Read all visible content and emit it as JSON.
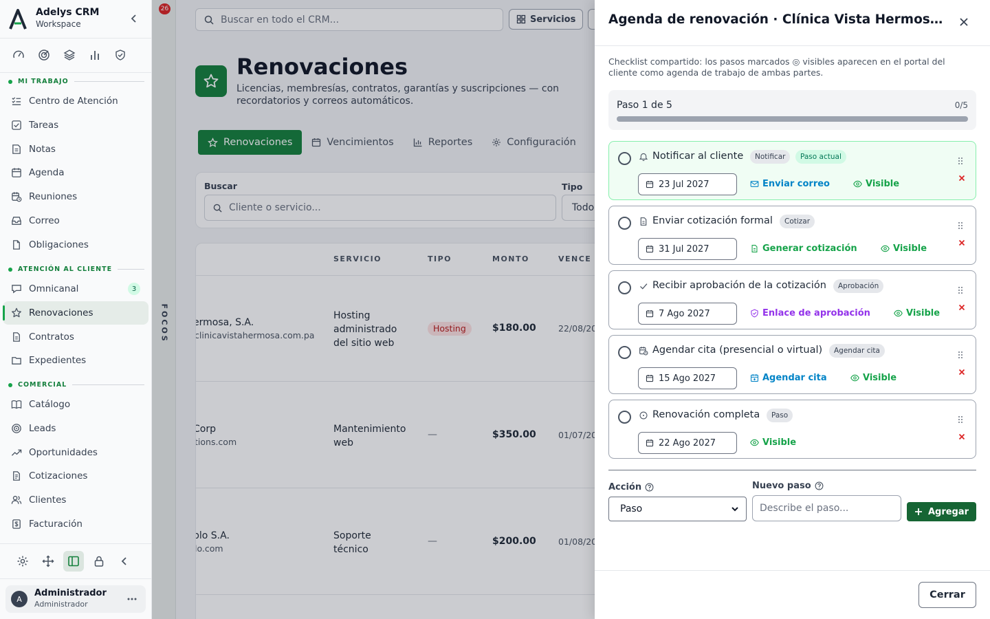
{
  "sidebar": {
    "brand_name": "Adelys CRM",
    "brand_sub": "Workspace",
    "sections": [
      {
        "label": "MI TRABAJO",
        "items": [
          {
            "label": "Centro de Atención",
            "icon": "list-check-icon"
          },
          {
            "label": "Tareas",
            "icon": "checkbox-icon"
          },
          {
            "label": "Notas",
            "icon": "note-icon"
          },
          {
            "label": "Agenda",
            "icon": "calendar-icon"
          },
          {
            "label": "Reuniones",
            "icon": "calendar-clock-icon"
          },
          {
            "label": "Correo",
            "icon": "inbox-icon"
          },
          {
            "label": "Obligaciones",
            "icon": "file-icon"
          }
        ]
      },
      {
        "label": "ATENCIÓN AL CLIENTE",
        "items": [
          {
            "label": "Omnicanal",
            "icon": "chat-icon",
            "badge": "3"
          },
          {
            "label": "Renovaciones",
            "icon": "star-icon",
            "active": true
          },
          {
            "label": "Contratos",
            "icon": "document-icon"
          },
          {
            "label": "Expedientes",
            "icon": "folder-icon"
          }
        ]
      },
      {
        "label": "COMERCIAL",
        "items": [
          {
            "label": "Catálogo",
            "icon": "book-icon"
          },
          {
            "label": "Leads",
            "icon": "target-icon"
          },
          {
            "label": "Oportunidades",
            "icon": "trend-icon"
          },
          {
            "label": "Cotizaciones",
            "icon": "quote-icon"
          },
          {
            "label": "Clientes",
            "icon": "users-icon"
          },
          {
            "label": "Facturación",
            "icon": "invoice-icon"
          }
        ]
      }
    ],
    "user_name": "Administrador",
    "user_role": "Administrador",
    "user_initial": "A"
  },
  "focos": {
    "label": "FOCOS",
    "count": "26"
  },
  "main": {
    "search_placeholder": "Buscar en todo el CRM...",
    "top_button": "Servicios",
    "title": "Renovaciones",
    "subtitle": "Licencias, membresías, contratos, garantías y suscripciones — con recordatorios y correos automáticos.",
    "tabs": [
      "Renovaciones",
      "Vencimientos",
      "Reportes",
      "Configuración"
    ],
    "filter_search_label": "Buscar",
    "filter_search_placeholder": "Cliente o servicio...",
    "filter_type_label": "Tipo",
    "filter_type_value": "Todo",
    "columns": [
      "SERVICIO",
      "TIPO",
      "MONTO",
      "VENCE"
    ],
    "rows": [
      {
        "client": "ermosa, S.A.",
        "email": "clinicavistahermosa.com.pa",
        "service": "Hosting administrado del sitio web",
        "type": "Hosting",
        "amount": "$180.00",
        "due": "22/08/20"
      },
      {
        "client": " Corp",
        "email": "tions.com",
        "service": "Mantenimiento web",
        "type": "—",
        "amount": "$350.00",
        "due": "01/07/20"
      },
      {
        "client": "plo S.A.",
        "email": "lo.com",
        "service": "Soporte técnico",
        "type": "—",
        "amount": "$200.00",
        "due": "01/08/20"
      }
    ]
  },
  "drawer": {
    "title": "Agenda de renovación · Clínica Vista Hermosa...",
    "description": "Checklist compartido: los pasos marcados ◎ visibles aparecen en el portal del cliente como agenda de trabajo de ambas partes.",
    "progress_label": "Paso 1 de 5",
    "progress_count": "0/5",
    "progress_fraction": 0,
    "visible_label": "Visible",
    "steps": [
      {
        "title": "Notificar al cliente",
        "tag": "Notificar",
        "current_tag": "Paso actual",
        "date": "23 Jul 2027",
        "action": "Enviar correo",
        "action_color": "#0284c7",
        "icon": "bell-icon",
        "action_icon": "mail-icon"
      },
      {
        "title": "Enviar cotización formal",
        "tag": "Cotizar",
        "date": "31 Jul 2027",
        "action": "Generar cotización",
        "action_color": "#16a34a",
        "icon": "document-icon",
        "action_icon": "document-icon"
      },
      {
        "title": "Recibir aprobación de la cotización",
        "tag": "Aprobación",
        "date": "7 Ago 2027",
        "action": "Enlace de aprobación",
        "action_color": "#9333ea",
        "icon": "check-icon",
        "action_icon": "shield-check-icon"
      },
      {
        "title": "Agendar cita (presencial o virtual)",
        "tag": "Agendar cita",
        "date": "15 Ago 2027",
        "action": "Agendar cita",
        "action_color": "#0284c7",
        "icon": "calendar-clock-icon",
        "action_icon": "calendar-plus-icon"
      },
      {
        "title": "Renovación completa",
        "tag": "Paso",
        "date": "22 Ago 2027",
        "action": "",
        "icon": "circle-dot-icon"
      }
    ],
    "action_label": "Acción",
    "action_value": "Paso",
    "new_step_label": "Nuevo paso",
    "new_step_placeholder": "Describe el paso...",
    "add_button": "Agregar",
    "close_button": "Cerrar"
  }
}
